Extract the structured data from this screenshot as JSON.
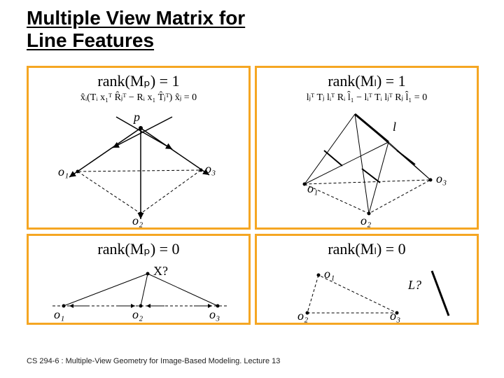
{
  "title_line1": "Multiple View Matrix for",
  "title_line2": "Line Features",
  "panels": {
    "tl": {
      "rank": "rank(Mₚ) = 1",
      "constraint": "x̂ᵢ(Tᵢ x₁ᵀ R̂ⱼᵀ − Rᵢ x₁ T̂ⱼᵀ) x̂ⱼ = 0",
      "labels": {
        "p": "p",
        "o1": "o₁",
        "o2": "o₂",
        "o3": "o₃"
      }
    },
    "tr": {
      "rank": "rank(Mₗ) = 1",
      "constraint": "lⱼᵀ Tⱼ lᵢᵀ Rᵢ l̂₁ − lᵢᵀ Tᵢ lⱼᵀ Rⱼ l̂₁ = 0",
      "labels": {
        "l": "l",
        "o1": "o₁",
        "o2": "o₂",
        "o3": "o₃"
      }
    },
    "bl": {
      "rank": "rank(Mₚ) = 0",
      "labels": {
        "X": "X?",
        "o1": "o₁",
        "o2": "o₂",
        "o3": "o₃"
      }
    },
    "br": {
      "rank": "rank(Mₗ) = 0",
      "labels": {
        "L": "L?",
        "o1": "o₁",
        "o2": "o₂",
        "o3": "o₃"
      }
    }
  },
  "footer": "CS 294-6 : Multiple-View Geometry for Image-Based Modeling. Lecture 13"
}
